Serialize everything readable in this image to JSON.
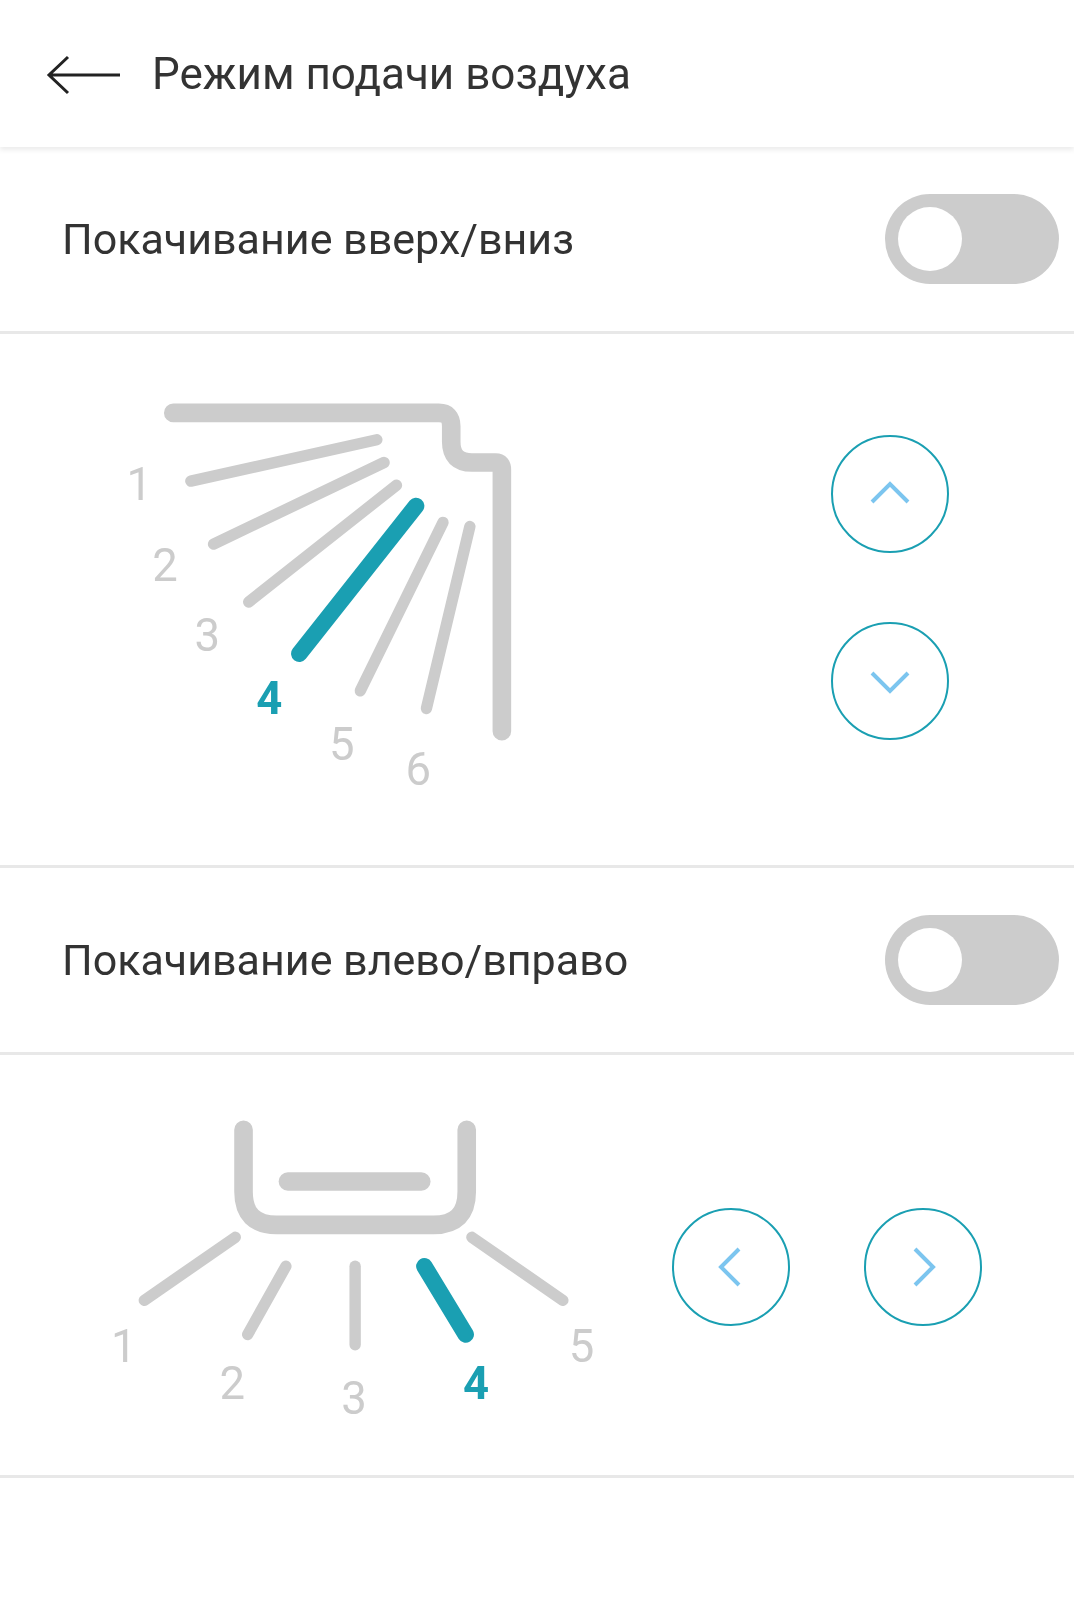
{
  "header": {
    "title": "Режим подачи воздуха"
  },
  "vertical": {
    "swing": {
      "label": "Покачивание вверх/вниз",
      "on": false
    },
    "positions": [
      {
        "label": "1",
        "selected": false
      },
      {
        "label": "2",
        "selected": false
      },
      {
        "label": "3",
        "selected": false
      },
      {
        "label": "4",
        "selected": true
      },
      {
        "label": "5",
        "selected": false
      },
      {
        "label": "6",
        "selected": false
      }
    ]
  },
  "horizontal": {
    "swing": {
      "label": "Покачивание влево/вправо",
      "on": false
    },
    "positions": [
      {
        "label": "1",
        "selected": false
      },
      {
        "label": "2",
        "selected": false
      },
      {
        "label": "3",
        "selected": false
      },
      {
        "label": "4",
        "selected": true
      },
      {
        "label": "5",
        "selected": false
      }
    ]
  }
}
